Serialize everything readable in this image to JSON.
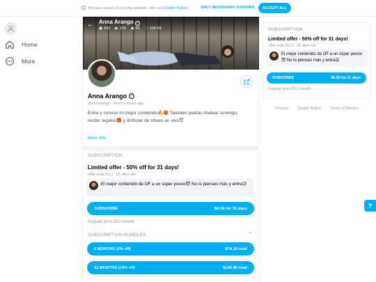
{
  "cookie": {
    "text": "We use cookies to run this website. See our",
    "link": "Cookie Notice",
    "necessary": "ONLY NECESSARY COOKIES",
    "accept": "ACCEPT ALL"
  },
  "sidebar": {
    "items": [
      {
        "label": "Home",
        "icon": "home-icon"
      },
      {
        "label": "More",
        "icon": "more-icon"
      }
    ]
  },
  "profile": {
    "name": "Anna Arango",
    "handle": "@annarango",
    "seen": "Seen 3 hours ago",
    "stats": {
      "photos": "690",
      "videos": "128",
      "streams": "65",
      "likes": "109.5K"
    },
    "bio_line1": "Entra y conoce mi mejor contenido🔥🥵 Tambien podrás chatear conmigo,",
    "bio_line2": "recibir regalos🎁 y disfrutar de shows en vivo😈",
    "more_info": "More info"
  },
  "subscription": {
    "title": "SUBSCRIPTION",
    "offer": "Limited offer - 50% off for 31 days!",
    "offer_ends": "Offer ends Oct 2",
    "offers_left": "25 offers left",
    "message": "El mejor contenido de OF a un súper precio😈 No lo pienses más y entra😉",
    "subscribe_label": "SUBSCRIBE",
    "subscribe_price": "$6.50 for 31 days",
    "regular_price": "Regular price $13 /month"
  },
  "bundles": {
    "title": "SUBSCRIPTION BUNDLES",
    "items": [
      {
        "label": "6 MONTHS (5% off)",
        "price": "$74.10 total"
      },
      {
        "label": "12 MONTHS (10% off)",
        "price": "$140.40 total"
      }
    ]
  },
  "footer": {
    "privacy": "Privacy",
    "cookie_notice": "Cookie Notice",
    "terms": "Terms of Service"
  },
  "colors": {
    "accent": "#00aff0",
    "muted": "#8a96a3"
  }
}
